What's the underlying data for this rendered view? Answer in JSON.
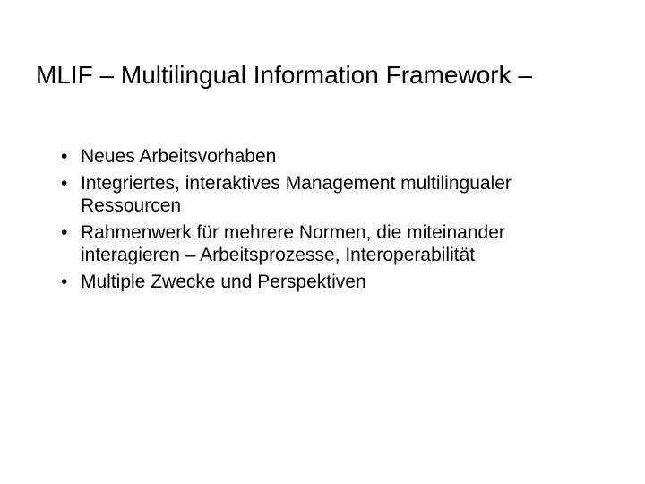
{
  "slide": {
    "title": "MLIF – Multilingual Information Framework –",
    "bullets": [
      "Neues Arbeitsvorhaben",
      "Integriertes, interaktives Management multilingualer Ressourcen",
      "Rahmenwerk für mehrere Normen, die miteinander interagieren – Arbeitsprozesse, Interoperabilität",
      "Multiple Zwecke und Perspektiven"
    ]
  }
}
